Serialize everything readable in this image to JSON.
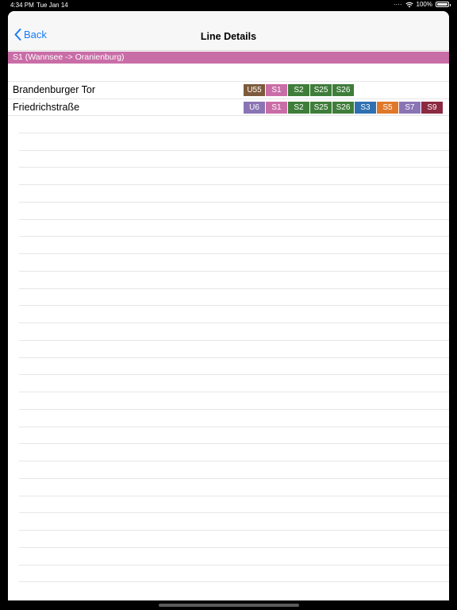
{
  "status_bar": {
    "time": "4:34 PM",
    "date": "Tue Jan 14",
    "battery": "100%",
    "icons": [
      "signal-dots-icon",
      "wifi-icon",
      "battery-icon"
    ]
  },
  "nav": {
    "back_label": "Back",
    "title": "Line Details"
  },
  "line": {
    "label": "S1 (Wannsee -> Oranienburg)",
    "color": "#c96da7"
  },
  "stations": [
    {
      "name": "Brandenburger Tor",
      "lines": [
        {
          "label": "U55",
          "color": "#7d5a3c"
        },
        {
          "label": "S1",
          "color": "#c96da7"
        },
        {
          "label": "S2",
          "color": "#3f7d3a"
        },
        {
          "label": "S25",
          "color": "#3f7d3a"
        },
        {
          "label": "S26",
          "color": "#3f7d3a"
        }
      ]
    },
    {
      "name": "Friedrichstraße",
      "lines": [
        {
          "label": "U6",
          "color": "#8a74b4"
        },
        {
          "label": "S1",
          "color": "#c96da7"
        },
        {
          "label": "S2",
          "color": "#3f7d3a"
        },
        {
          "label": "S25",
          "color": "#3f7d3a"
        },
        {
          "label": "S26",
          "color": "#3f7d3a"
        },
        {
          "label": "S3",
          "color": "#2f6fb2"
        },
        {
          "label": "S5",
          "color": "#e0782a"
        },
        {
          "label": "S7",
          "color": "#8a74b4"
        },
        {
          "label": "S9",
          "color": "#8b2a41"
        }
      ]
    }
  ]
}
